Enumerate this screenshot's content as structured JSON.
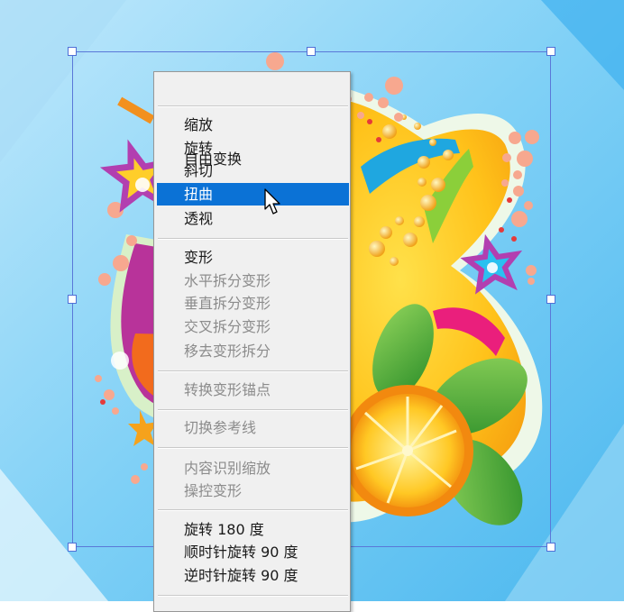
{
  "context_menu": {
    "items": [
      {
        "label": "自由变换",
        "enabled": true
      },
      {
        "label": "缩放",
        "enabled": true
      },
      {
        "label": "旋转",
        "enabled": true
      },
      {
        "label": "斜切",
        "enabled": true
      },
      {
        "label": "扭曲",
        "enabled": true,
        "highlighted": true
      },
      {
        "label": "透视",
        "enabled": true
      },
      {
        "label": "变形",
        "enabled": true
      },
      {
        "label": "水平拆分变形",
        "enabled": false
      },
      {
        "label": "垂直拆分变形",
        "enabled": false
      },
      {
        "label": "交叉拆分变形",
        "enabled": false
      },
      {
        "label": "移去变形拆分",
        "enabled": false
      },
      {
        "label": "转换变形锚点",
        "enabled": false
      },
      {
        "label": "切换参考线",
        "enabled": false
      },
      {
        "label": "内容识别缩放",
        "enabled": false
      },
      {
        "label": "操控变形",
        "enabled": false
      },
      {
        "label": "旋转 180 度",
        "enabled": true
      },
      {
        "label": "顺时针旋转 90 度",
        "enabled": true
      },
      {
        "label": "逆时针旋转 90 度",
        "enabled": true
      }
    ]
  },
  "colors": {
    "highlight": "#0b72d6",
    "menu_background": "#f0f0f0",
    "disabled_text": "#8c8c8c",
    "bounding_box": "#5a78d8"
  }
}
